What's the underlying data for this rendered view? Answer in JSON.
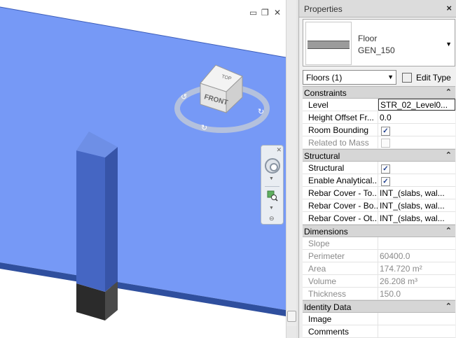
{
  "window_controls": {
    "minimize": "▭",
    "restore": "❐",
    "close": "✕"
  },
  "viewcube": {
    "top": "TOP",
    "front": "FRONT"
  },
  "properties": {
    "title": "Properties",
    "close": "×",
    "type_family": "Floor",
    "type_name": "GEN_150",
    "filter_label": "Floors (1)",
    "edit_type": "Edit Type",
    "groups": [
      {
        "label": "Constraints",
        "rows": [
          {
            "name": "Level",
            "value": "STR_02_Level0...",
            "editable": true,
            "active": true
          },
          {
            "name": "Height Offset Fr...",
            "value": "0.0",
            "editable": true
          },
          {
            "name": "Room Bounding",
            "checkbox": true,
            "checked": true,
            "editable": true
          },
          {
            "name": "Related to Mass",
            "checkbox": true,
            "checked": false,
            "editable": false
          }
        ]
      },
      {
        "label": "Structural",
        "rows": [
          {
            "name": "Structural",
            "checkbox": true,
            "checked": true,
            "editable": true
          },
          {
            "name": "Enable Analytical...",
            "checkbox": true,
            "checked": true,
            "editable": true
          },
          {
            "name": "Rebar Cover - To...",
            "value": "INT_(slabs, wal...",
            "editable": true
          },
          {
            "name": "Rebar Cover - Bo...",
            "value": "INT_(slabs, wal...",
            "editable": true
          },
          {
            "name": "Rebar Cover - Ot...",
            "value": "INT_(slabs, wal...",
            "editable": true
          }
        ]
      },
      {
        "label": "Dimensions",
        "rows": [
          {
            "name": "Slope",
            "value": "",
            "editable": false
          },
          {
            "name": "Perimeter",
            "value": "60400.0",
            "editable": false
          },
          {
            "name": "Area",
            "value": "174.720 m²",
            "editable": false
          },
          {
            "name": "Volume",
            "value": "26.208 m³",
            "editable": false
          },
          {
            "name": "Thickness",
            "value": "150.0",
            "editable": false
          }
        ]
      },
      {
        "label": "Identity Data",
        "rows": [
          {
            "name": "Image",
            "value": "",
            "editable": true
          },
          {
            "name": "Comments",
            "value": "",
            "editable": true
          }
        ]
      }
    ]
  },
  "colors": {
    "slab": "#6f94f5",
    "column": "#4a6bc2",
    "palette_bg": "#f0f0f0"
  }
}
